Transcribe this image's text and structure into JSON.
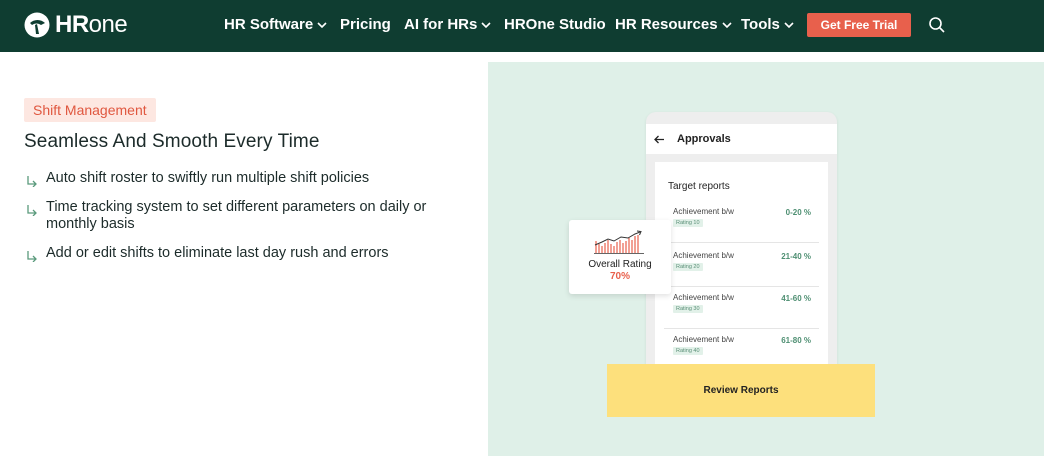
{
  "brand": {
    "name_bold": "HR",
    "name_light": "one"
  },
  "nav": {
    "items": [
      {
        "label": "HR Software",
        "has_dropdown": true
      },
      {
        "label": "Pricing",
        "has_dropdown": false
      },
      {
        "label": "AI for HRs",
        "has_dropdown": true
      },
      {
        "label": "HROne Studio",
        "has_dropdown": false
      },
      {
        "label": "HR Resources",
        "has_dropdown": true
      },
      {
        "label": "Tools",
        "has_dropdown": true
      }
    ],
    "cta_label": "Get Free Trial",
    "search_icon": "search-icon"
  },
  "section": {
    "tag": "Shift Management",
    "heading": "Seamless And Smooth Every Time",
    "features": [
      {
        "line1": "Auto shift roster to swiftly run multiple shift policies",
        "line2": ""
      },
      {
        "line1": "Time tracking system to set different parameters on daily or",
        "line2": "monthly basis"
      },
      {
        "line1": "Add or edit shifts to eliminate last day rush and errors",
        "line2": ""
      }
    ]
  },
  "illustration": {
    "phone_title": "Approvals",
    "card_title": "Target reports",
    "rows": [
      {
        "label": "Achievement b/w",
        "badge": "Rating 10",
        "range": "0-20 %"
      },
      {
        "label": "Achievement b/w",
        "badge": "Rating 20",
        "range": "21-40 %"
      },
      {
        "label": "Achievement b/w",
        "badge": "Rating 30",
        "range": "41-60 %"
      },
      {
        "label": "Achievement b/w",
        "badge": "Rating 40",
        "range": "61-80 %"
      }
    ],
    "rating": {
      "label": "Overall Rating",
      "value": "70%"
    },
    "review_button": "Review Reports"
  },
  "colors": {
    "nav_bg": "#0f3d31",
    "cta": "#e8604c",
    "tag_bg": "#fde7e1",
    "tag_text": "#e0573f",
    "panel_bg": "#dff0e8",
    "review_bg": "#fde07c",
    "range_text": "#4e8f72"
  }
}
